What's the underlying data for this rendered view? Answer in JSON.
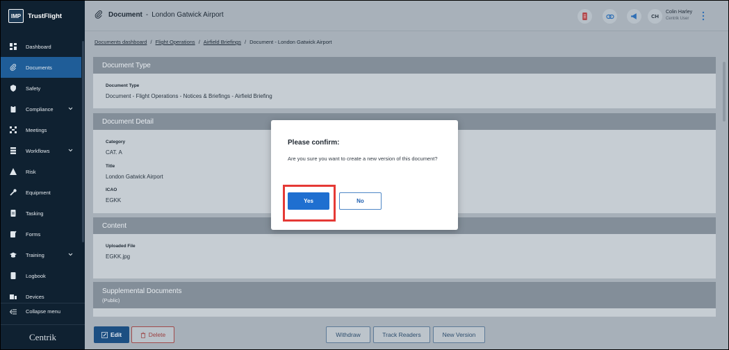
{
  "brand": {
    "logo_text": "IMP",
    "name": "TrustFlight"
  },
  "sidebar": {
    "items": [
      {
        "label": "Dashboard",
        "icon": "dashboard-icon",
        "active": false
      },
      {
        "label": "Documents",
        "icon": "paperclip-icon",
        "active": true
      },
      {
        "label": "Safety",
        "icon": "shield-icon",
        "active": false
      },
      {
        "label": "Compliance",
        "icon": "clipboard-icon",
        "active": false,
        "expandable": true
      },
      {
        "label": "Meetings",
        "icon": "meetings-icon",
        "active": false
      },
      {
        "label": "Workflows",
        "icon": "workflow-icon",
        "active": false,
        "expandable": true
      },
      {
        "label": "Risk",
        "icon": "warning-icon",
        "active": false
      },
      {
        "label": "Equipment",
        "icon": "wrench-icon",
        "active": false
      },
      {
        "label": "Tasking",
        "icon": "task-icon",
        "active": false
      },
      {
        "label": "Forms",
        "icon": "forms-icon",
        "active": false
      },
      {
        "label": "Training",
        "icon": "graduation-cap-icon",
        "active": false,
        "expandable": true
      },
      {
        "label": "Logbook",
        "icon": "book-icon",
        "active": false
      },
      {
        "label": "Devices",
        "icon": "devices-icon",
        "active": false
      }
    ],
    "collapse_label": "Collapse menu",
    "footer_logo": "Centrik"
  },
  "header": {
    "type": "Document",
    "separator": "-",
    "name": "London Gatwick Airport",
    "user": {
      "initials": "CH",
      "name": "Colin Harley",
      "role": "Centrik User"
    }
  },
  "breadcrumb": {
    "items": [
      "Documents dashboard",
      "Flight Operations",
      "Airfield Briefings"
    ],
    "separator": "/",
    "current": "Document - London Gatwick Airport"
  },
  "sections": {
    "document_type": {
      "title": "Document Type",
      "label": "Document Type",
      "value": "Document - Flight Operations - Notices & Briefings - Airfield Briefing"
    },
    "document_detail": {
      "title": "Document Detail",
      "category_label": "Category",
      "category_value": "CAT. A",
      "title_label": "Title",
      "title_value": "London Gatwick Airport",
      "icao_label": "ICAO",
      "icao_value": "EGKK"
    },
    "content": {
      "title": "Content",
      "file_label": "Uploaded File",
      "file_value": "EGKK.jpg"
    },
    "supplemental": {
      "title": "Supplemental Documents",
      "subtitle": "(Public)"
    }
  },
  "actions": {
    "edit": "Edit",
    "delete": "Delete",
    "withdraw": "Withdraw",
    "track_readers": "Track Readers",
    "new_version": "New Version"
  },
  "dialog": {
    "title": "Please confirm:",
    "message": "Are you sure you want to create a new version of this document?",
    "yes": "Yes",
    "no": "No"
  },
  "colors": {
    "sidebar_bg": "#0f2131",
    "active_item": "#1f5d98",
    "primary_button": "#1f6fd0",
    "highlight": "#e53935"
  }
}
